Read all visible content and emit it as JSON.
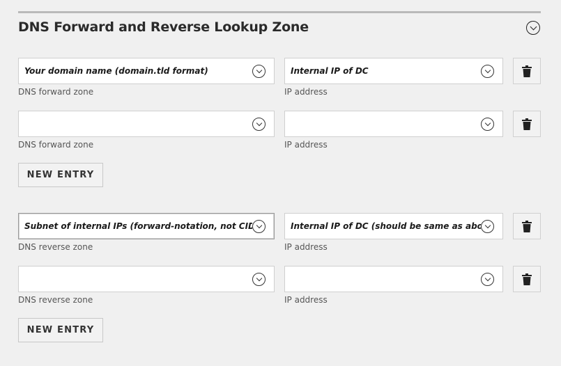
{
  "section": {
    "title": "DNS Forward and Reverse Lookup Zone"
  },
  "forward": {
    "rows": [
      {
        "zone_value": "Your domain name (domain.tld format)",
        "zone_label": "DNS forward zone",
        "ip_value": "Internal IP of DC",
        "ip_label": "IP address"
      },
      {
        "zone_value": "",
        "zone_label": "DNS forward zone",
        "ip_value": "",
        "ip_label": "IP address"
      }
    ],
    "new_entry_label": "NEW ENTRY"
  },
  "reverse": {
    "rows": [
      {
        "zone_value": "Subnet of internal IPs (forward-notation, not CIDR)",
        "zone_label": "DNS reverse zone",
        "ip_value": "Internal IP of DC (should be same as above)",
        "ip_label": "IP address"
      },
      {
        "zone_value": "",
        "zone_label": "DNS reverse zone",
        "ip_value": "",
        "ip_label": "IP address"
      }
    ],
    "new_entry_label": "NEW ENTRY"
  },
  "icons": {
    "collapse": "chevron-down-circle-icon",
    "dropdown": "chevron-down-circle-icon",
    "delete": "trash-icon"
  }
}
